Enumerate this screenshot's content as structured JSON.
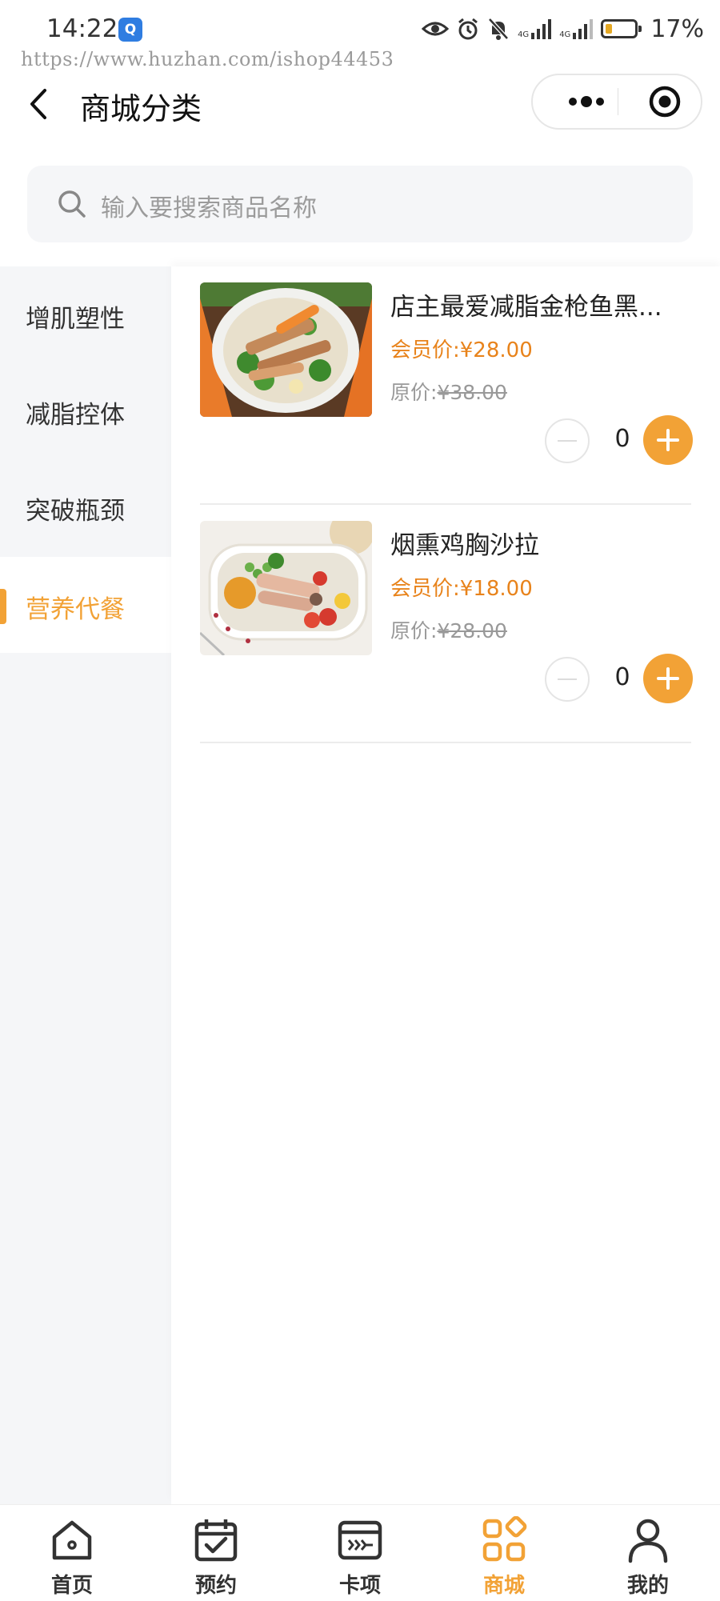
{
  "status_bar": {
    "time": "14:22",
    "app_badge": "Q",
    "net1": "4G",
    "net2": "4G",
    "battery_level": 0.17,
    "battery": "17%"
  },
  "watermark": "https://www.huzhan.com/ishop44453",
  "header": {
    "title": "商城分类"
  },
  "search": {
    "placeholder": "输入要搜索商品名称"
  },
  "categories": [
    {
      "label": "增肌塑性",
      "active": false
    },
    {
      "label": "减脂控体",
      "active": false
    },
    {
      "label": "突破瓶颈",
      "active": false
    },
    {
      "label": "营养代餐",
      "active": true
    }
  ],
  "products": [
    {
      "name": "店主最爱减脂金枪鱼黑...",
      "member_label": "会员价:",
      "member_price": "¥28.00",
      "orig_label": "原价:",
      "orig_price": "¥38.00",
      "qty": "0"
    },
    {
      "name": "烟熏鸡胸沙拉",
      "member_label": "会员价:",
      "member_price": "¥18.00",
      "orig_label": "原价:",
      "orig_price": "¥28.00",
      "qty": "0"
    }
  ],
  "tabbar": [
    {
      "label": "首页",
      "icon": "home-icon",
      "active": false
    },
    {
      "label": "预约",
      "icon": "calendar-check-icon",
      "active": false
    },
    {
      "label": "卡项",
      "icon": "card-icon",
      "active": false
    },
    {
      "label": "商城",
      "icon": "grid-shop-icon",
      "active": true
    },
    {
      "label": "我的",
      "icon": "user-icon",
      "active": false
    }
  ],
  "colors": {
    "accent": "#f2a236",
    "price": "#e8831b",
    "sidebar_bg": "#f5f6f8"
  }
}
